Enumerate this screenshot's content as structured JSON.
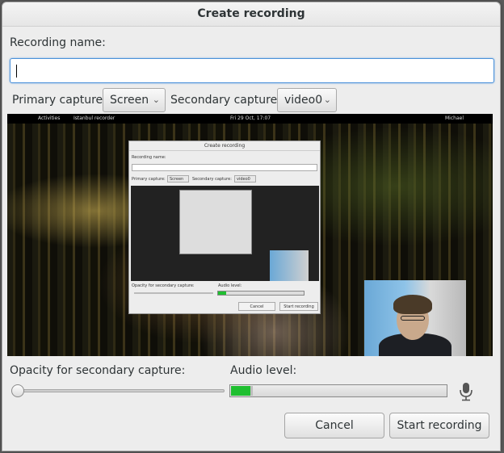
{
  "dialog": {
    "title": "Create recording"
  },
  "form": {
    "name_label": "Recording name:",
    "name_value": "",
    "primary_label": "Primary capture:",
    "primary_value": "Screen",
    "secondary_label": "Secondary capture:",
    "secondary_value": "video0",
    "opacity_label": "Opacity for secondary capture:",
    "opacity_value": 0.0,
    "audio_label": "Audio level:",
    "audio_level": 0.09
  },
  "preview": {
    "topbar": {
      "activities": "Activities",
      "app": "Istanbul recorder",
      "clock": "Fri 29 Oct, 17:07",
      "user": "Michael"
    },
    "nested_dialog": {
      "title": "Create recording",
      "name_label": "Recording name:",
      "primary_label": "Primary capture:",
      "primary_value": "Screen",
      "secondary_label": "Secondary capture:",
      "secondary_value": "video0",
      "opacity_label": "Opacity for secondary capture:",
      "audio_label": "Audio level:",
      "cancel_label": "Cancel",
      "start_label": "Start recording"
    }
  },
  "actions": {
    "cancel_label": "Cancel",
    "start_label": "Start recording"
  },
  "colors": {
    "level_fill": "#1fbf30",
    "focus_border": "#4a90d9"
  },
  "icons": {
    "chevron": "chevron-down-icon",
    "mic": "microphone-icon"
  }
}
